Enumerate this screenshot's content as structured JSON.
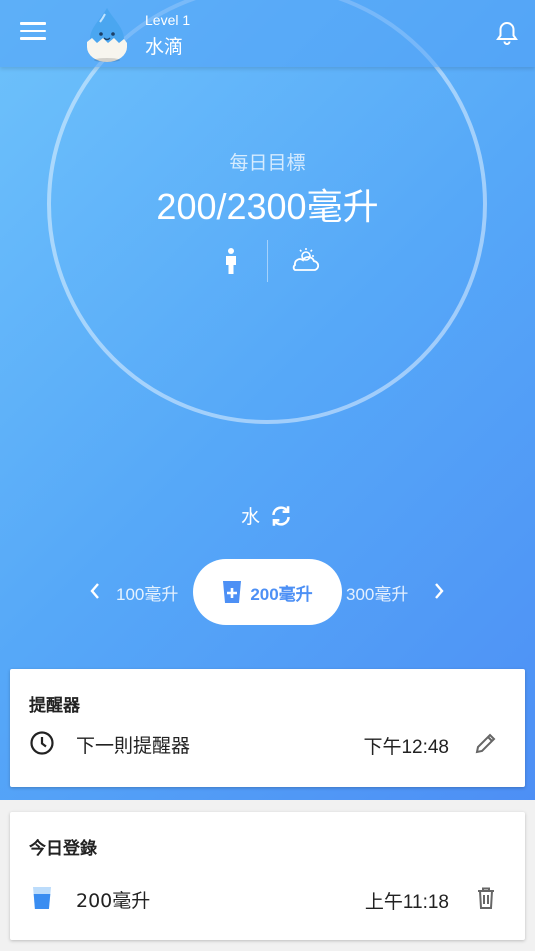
{
  "header": {
    "level": "Level 1",
    "character_name": "水滴",
    "icons": {
      "menu": "menu-icon",
      "bell": "bell-icon",
      "avatar": "water-drop-mascot"
    }
  },
  "goal": {
    "label": "每日目標",
    "value": "200/2300毫升",
    "icons": [
      "person-icon",
      "weather-icon"
    ]
  },
  "drink": {
    "type_label": "水",
    "switch_icon": "sync-icon"
  },
  "cup_sizes": {
    "prev": "100毫升",
    "selected": "200毫升",
    "next": "300毫升"
  },
  "reminder_card": {
    "title": "提醒器",
    "row_label": "下一則提醒器",
    "time": "下午12:48"
  },
  "log_card": {
    "title": "今日登錄",
    "entries": [
      {
        "amount": "200毫升",
        "time": "上午11:18"
      }
    ]
  },
  "colors": {
    "accent": "#4d90f5",
    "gradient_start": "#6ec2fb",
    "gradient_end": "#4d8ff5"
  }
}
